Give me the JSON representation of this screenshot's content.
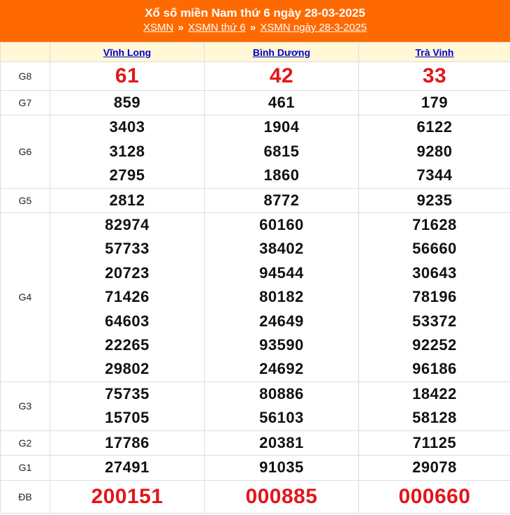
{
  "header": {
    "title": "Xổ số miền Nam thứ 6 ngày 28-03-2025",
    "breadcrumb": {
      "link1": "XSMN",
      "sep1": "»",
      "link2": "XSMN thứ 6",
      "sep2": "»",
      "link3": "XSMN ngày 28-3-2025"
    }
  },
  "provinces": [
    "Vĩnh Long",
    "Bình Dương",
    "Trà Vinh"
  ],
  "prizes": [
    {
      "label": "G8",
      "values": [
        [
          "61"
        ],
        [
          "42"
        ],
        [
          "33"
        ]
      ]
    },
    {
      "label": "G7",
      "values": [
        [
          "859"
        ],
        [
          "461"
        ],
        [
          "179"
        ]
      ]
    },
    {
      "label": "G6",
      "values": [
        [
          "3403",
          "3128",
          "2795"
        ],
        [
          "1904",
          "6815",
          "1860"
        ],
        [
          "6122",
          "9280",
          "7344"
        ]
      ]
    },
    {
      "label": "G5",
      "values": [
        [
          "2812"
        ],
        [
          "8772"
        ],
        [
          "9235"
        ]
      ]
    },
    {
      "label": "G4",
      "values": [
        [
          "82974",
          "57733",
          "20723",
          "71426",
          "64603",
          "22265",
          "29802"
        ],
        [
          "60160",
          "38402",
          "94544",
          "80182",
          "24649",
          "93590",
          "24692"
        ],
        [
          "71628",
          "56660",
          "30643",
          "78196",
          "53372",
          "92252",
          "96186"
        ]
      ]
    },
    {
      "label": "G3",
      "values": [
        [
          "75735",
          "15705"
        ],
        [
          "80886",
          "56103"
        ],
        [
          "18422",
          "58128"
        ]
      ]
    },
    {
      "label": "G2",
      "values": [
        [
          "17786"
        ],
        [
          "20381"
        ],
        [
          "71125"
        ]
      ]
    },
    {
      "label": "G1",
      "values": [
        [
          "27491"
        ],
        [
          "91035"
        ],
        [
          "29078"
        ]
      ]
    },
    {
      "label": "ĐB",
      "values": [
        [
          "200151"
        ],
        [
          "000885"
        ],
        [
          "000660"
        ]
      ]
    }
  ],
  "colors": {
    "header_bg": "#ff6a00",
    "province_row_bg": "#fff7d6",
    "highlight_red": "#e2161a",
    "link_blue": "#0000cc"
  }
}
